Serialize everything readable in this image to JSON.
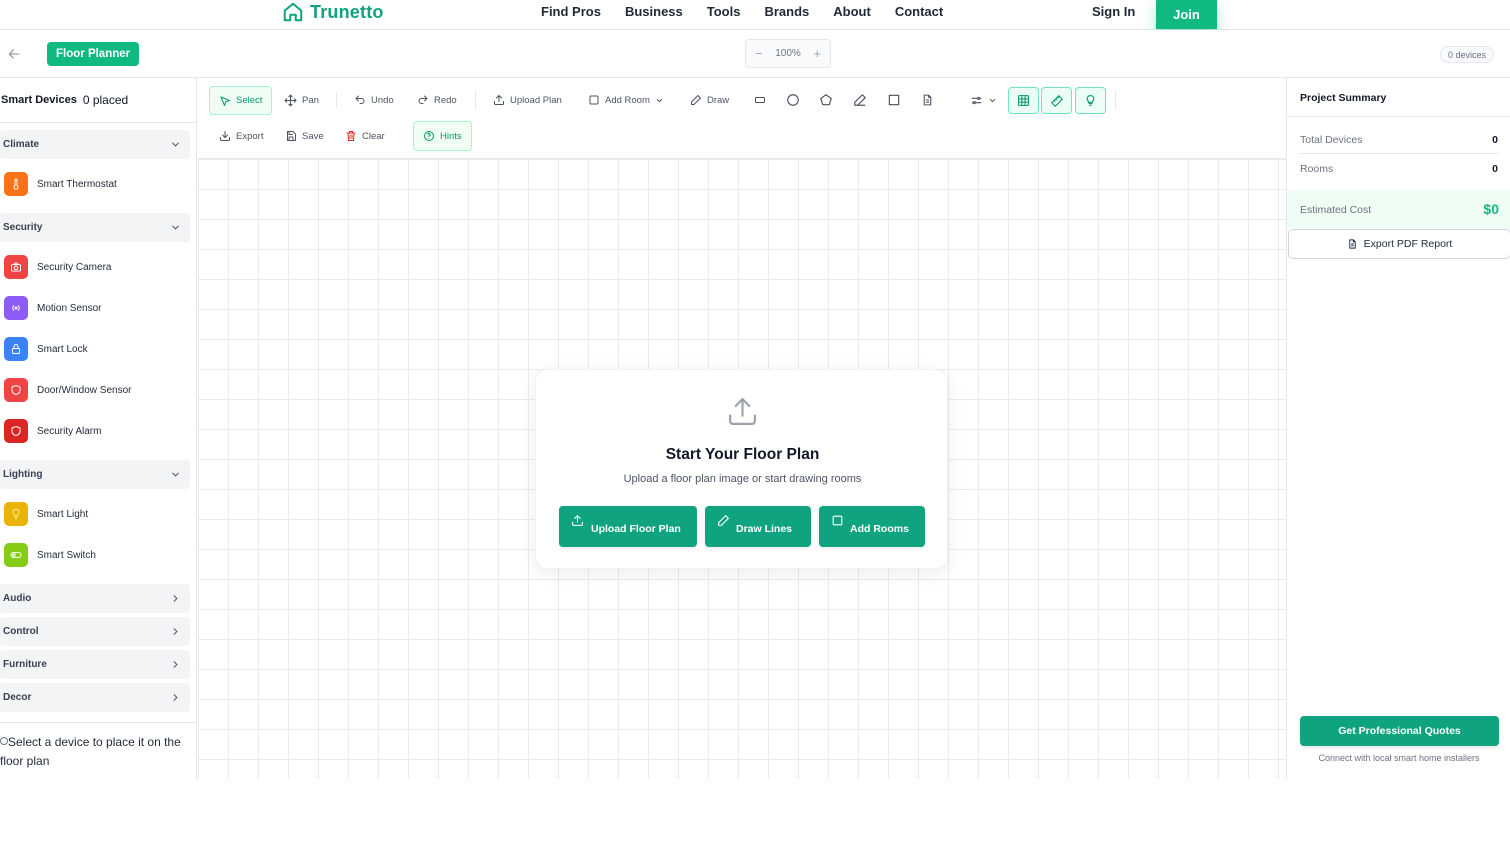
{
  "nav": {
    "brand": "Trunetto",
    "links": [
      "Find Pros",
      "Business",
      "Tools",
      "Brands",
      "About",
      "Contact"
    ],
    "sign_in": "Sign In",
    "join": "Join"
  },
  "subbar": {
    "badge": "Floor Planner",
    "zoom_minus": "−",
    "zoom_level": "100%",
    "zoom_plus": "+",
    "devices_pill": "0 devices"
  },
  "sidebar": {
    "title": "Smart Devices",
    "count": "0 placed",
    "categories": {
      "climate": "Climate",
      "security": "Security",
      "lighting": "Lighting",
      "audio": "Audio",
      "control": "Control",
      "furniture": "Furniture",
      "decor": "Decor"
    },
    "devices": {
      "thermostat": "Smart Thermostat",
      "camera": "Security Camera",
      "motion": "Motion Sensor",
      "lock": "Smart Lock",
      "doorwindow": "Door/Window Sensor",
      "alarm": "Security Alarm",
      "light": "Smart Light",
      "switch": "Smart Switch"
    },
    "hint": "Select a device to place it on the floor plan"
  },
  "toolbar": {
    "select": "Select",
    "pan": "Pan",
    "undo": "Undo",
    "redo": "Redo",
    "upload_plan": "Upload Plan",
    "add_room": "Add Room",
    "draw": "Draw",
    "export": "Export",
    "save": "Save",
    "clear": "Clear",
    "hints": "Hints"
  },
  "canvas": {
    "title": "Start Your Floor Plan",
    "subtitle": "Upload a floor plan image or start drawing rooms",
    "upload_btn": "Upload Floor Plan",
    "draw_btn": "Draw Lines",
    "rooms_btn": "Add Rooms"
  },
  "summary": {
    "title": "Project Summary",
    "total_devices_label": "Total Devices",
    "total_devices": "0",
    "rooms_label": "Rooms",
    "rooms": "0",
    "cost_label": "Estimated Cost",
    "cost": "$0",
    "export_pdf": "Export PDF Report",
    "quotes_btn": "Get Professional Quotes",
    "quotes_note": "Connect with local smart home installers"
  },
  "colors": {
    "accent": "#10b981",
    "accent_dark": "#0fa47f",
    "thermostat": "#f97316",
    "camera": "#ef4444",
    "motion": "#8b5cf6",
    "lock": "#3b82f6",
    "doorwindow": "#ef4444",
    "alarm": "#dc2626",
    "light": "#eab308",
    "switch": "#84cc16"
  },
  "icons": [
    "home-icon",
    "arrow-left-icon",
    "chevron-down-icon",
    "chevron-right-icon",
    "thermometer-icon",
    "camera-icon",
    "radio-icon",
    "lock-icon",
    "shield-icon",
    "bulb-icon",
    "toggle-icon",
    "pointer-icon",
    "move-icon",
    "undo-icon",
    "redo-icon",
    "upload-icon",
    "square-icon",
    "pencil-icon",
    "rectangle-icon",
    "circle-icon",
    "pentagon-icon",
    "file-icon",
    "sliders-icon",
    "grid-icon",
    "ruler-icon",
    "download-icon",
    "save-icon",
    "trash-icon",
    "help-circle-icon"
  ]
}
